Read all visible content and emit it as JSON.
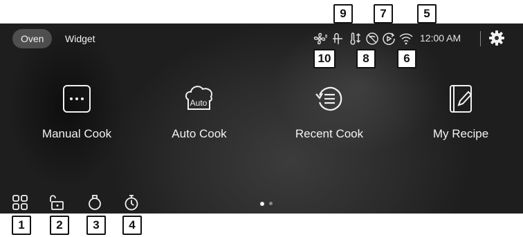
{
  "header": {
    "tabs": [
      {
        "label": "Oven",
        "active": true
      },
      {
        "label": "Widget",
        "active": false
      }
    ],
    "time": "12:00 AM",
    "status_icons": [
      "fan-icon",
      "lock-icon",
      "temperature-probe-icon",
      "wifi-off-icon",
      "remote-start-icon",
      "wifi-icon"
    ],
    "settings_icon": "gear-icon"
  },
  "tiles": [
    {
      "label": "Manual Cook",
      "icon": "manual-cook-icon"
    },
    {
      "label": "Auto Cook",
      "icon": "auto-cook-icon",
      "icon_text": "Auto"
    },
    {
      "label": "Recent Cook",
      "icon": "recent-cook-icon"
    },
    {
      "label": "My Recipe",
      "icon": "my-recipe-icon"
    }
  ],
  "bottom_icons": [
    "apps-grid-icon",
    "unlock-icon",
    "kitchen-timer-icon",
    "stopwatch-icon"
  ],
  "pagination": {
    "pages": 2,
    "current": 1
  },
  "callouts": [
    "1",
    "2",
    "3",
    "4",
    "5",
    "6",
    "7",
    "8",
    "9",
    "10"
  ],
  "colors": {
    "foreground": "#f2f2f2",
    "background": "#262626",
    "callout_border": "#111111"
  }
}
